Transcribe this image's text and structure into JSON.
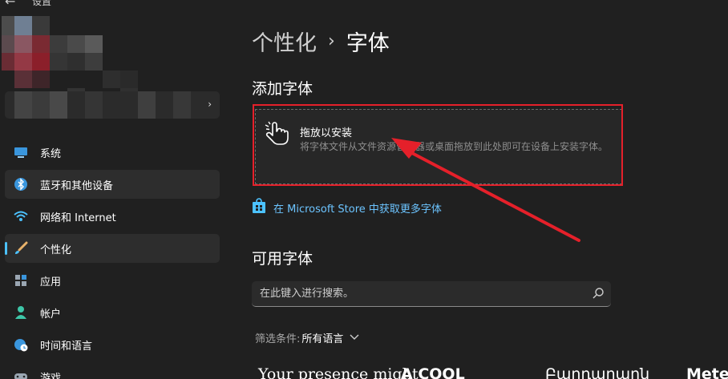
{
  "titlebar": {
    "back_icon": "back-arrow-icon",
    "app_title": "设置"
  },
  "sidebar": {
    "items": [
      {
        "label": "系统",
        "icon": "monitor-icon",
        "state": "normal"
      },
      {
        "label": "蓝牙和其他设备",
        "icon": "bluetooth-icon",
        "state": "hover"
      },
      {
        "label": "网络和 Internet",
        "icon": "wifi-icon",
        "state": "normal"
      },
      {
        "label": "个性化",
        "icon": "brush-icon",
        "state": "active"
      },
      {
        "label": "应用",
        "icon": "apps-icon",
        "state": "normal"
      },
      {
        "label": "帐户",
        "icon": "account-icon",
        "state": "normal"
      },
      {
        "label": "时间和语言",
        "icon": "globe-clock-icon",
        "state": "normal"
      },
      {
        "label": "游戏",
        "icon": "gamepad-icon",
        "state": "normal"
      }
    ]
  },
  "breadcrumb": {
    "parent": "个性化",
    "separator": "›",
    "current": "字体"
  },
  "add_fonts": {
    "title": "添加字体",
    "drop_title": "拖放以安装",
    "drop_desc": "将字体文件从文件资源管理器或桌面拖放到此处即可在设备上安装字体。",
    "store_link": "在 Microsoft Store 中获取更多字体"
  },
  "available_fonts": {
    "title": "可用字体",
    "search_placeholder": "在此键入进行搜索。",
    "filter_label": "筛选条件:",
    "filter_value": "所有语言",
    "previews": [
      "Your presence might",
      "A COOL",
      "Բարդարարն",
      "Meteo"
    ]
  },
  "colors": {
    "background": "#202020",
    "accent": "#4cc2ff",
    "link": "#6cc4ff",
    "annotation": "#e5202a"
  }
}
